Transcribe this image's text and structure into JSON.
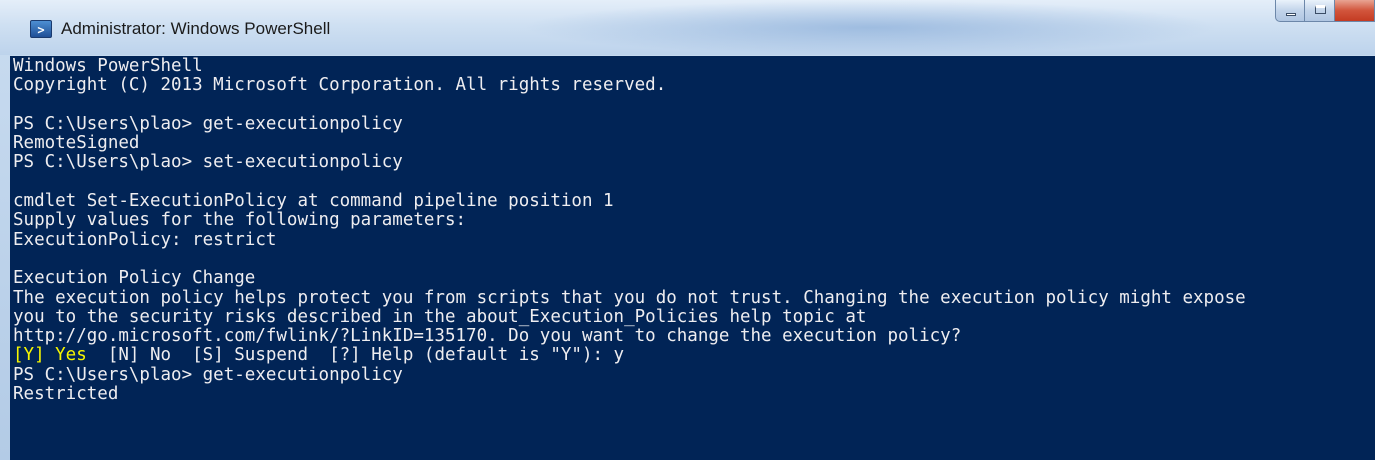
{
  "window": {
    "title": "Administrator: Windows PowerShell",
    "icon": "powershell-icon",
    "icon_glyph": ">",
    "controls": [
      "minimize-icon",
      "maximize-icon",
      "close-icon"
    ]
  },
  "console": {
    "background_color": "#012456",
    "text_color": "#eeedf0",
    "highlight_color": "#f6f600",
    "lines": {
      "l1": "Windows PowerShell",
      "l2": "Copyright (C) 2013 Microsoft Corporation. All rights reserved.",
      "l3": "",
      "l4": "PS C:\\Users\\plao> get-executionpolicy",
      "l5": "RemoteSigned",
      "l6": "PS C:\\Users\\plao> set-executionpolicy",
      "l7": "",
      "l8": "cmdlet Set-ExecutionPolicy at command pipeline position 1",
      "l9": "Supply values for the following parameters:",
      "l10": "ExecutionPolicy: restrict",
      "l11": "",
      "l12": "Execution Policy Change",
      "l13": "The execution policy helps protect you from scripts that you do not trust. Changing the execution policy might expose",
      "l14": "you to the security risks described in the about_Execution_Policies help topic at",
      "l15": "http://go.microsoft.com/fwlink/?LinkID=135170. Do you want to change the execution policy?",
      "l16_yes": "[Y] Yes",
      "l16_rest": "  [N] No  [S] Suspend  [?] Help (default is \"Y\"): y",
      "l17": "PS C:\\Users\\plao> get-executionpolicy",
      "l18": "Restricted"
    }
  }
}
